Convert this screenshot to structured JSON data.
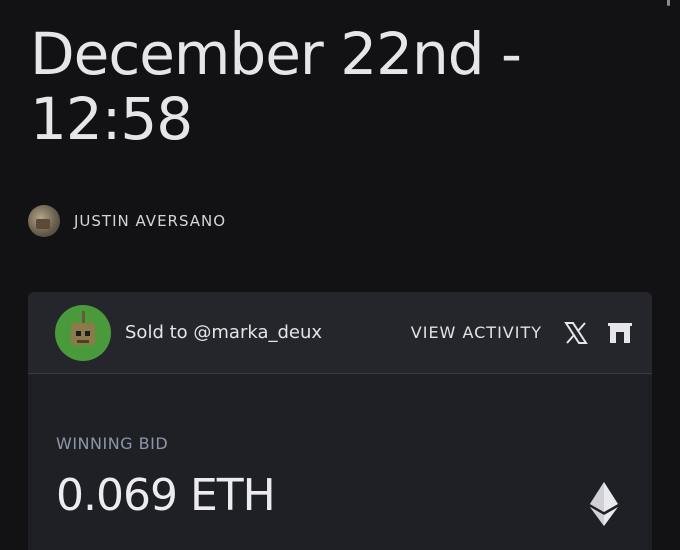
{
  "auction": {
    "title": "December 22nd - 12:58",
    "author": "JUSTIN AVERSANO"
  },
  "sale": {
    "sold_text": "Sold to @marka_deux",
    "view_activity": "VIEW ACTIVITY",
    "icons": [
      "x-logo-icon",
      "foundation-logo-icon",
      "ethereum-icon"
    ]
  },
  "bid": {
    "label": "WINNING BID",
    "value": "0.069 ETH"
  }
}
